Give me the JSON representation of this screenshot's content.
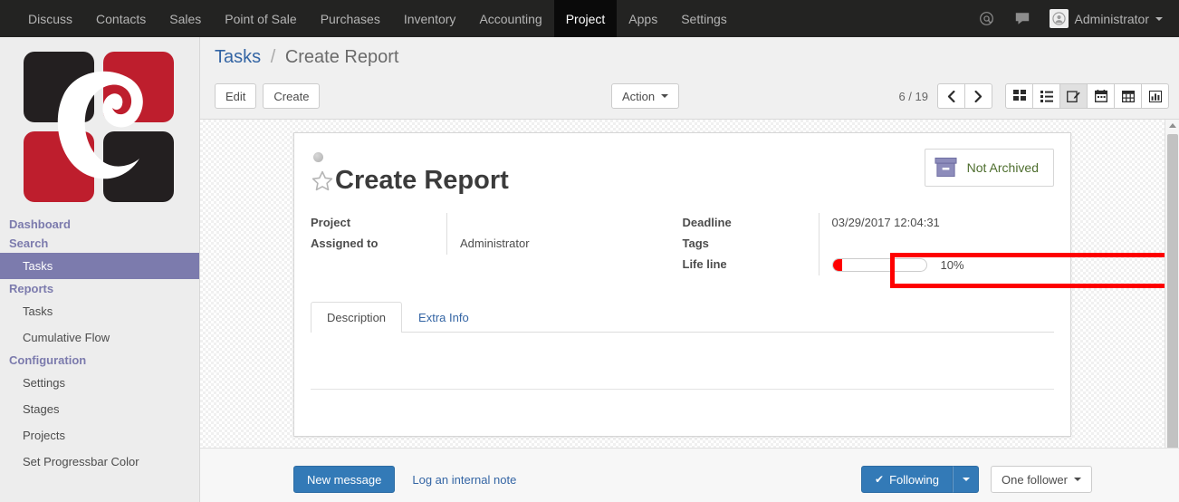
{
  "navbar": {
    "menus": [
      {
        "label": "Discuss",
        "active": false
      },
      {
        "label": "Contacts",
        "active": false
      },
      {
        "label": "Sales",
        "active": false
      },
      {
        "label": "Point of Sale",
        "active": false
      },
      {
        "label": "Purchases",
        "active": false
      },
      {
        "label": "Inventory",
        "active": false
      },
      {
        "label": "Accounting",
        "active": false
      },
      {
        "label": "Project",
        "active": true
      },
      {
        "label": "Apps",
        "active": false
      },
      {
        "label": "Settings",
        "active": false
      }
    ],
    "icons": [
      "at-sign-icon",
      "chat-bubble-icon"
    ],
    "user_name": "Administrator"
  },
  "sidebar": {
    "logo_name": "company-logo",
    "sections": [
      {
        "type": "group",
        "label": "Dashboard"
      },
      {
        "type": "group",
        "label": "Search"
      },
      {
        "type": "item",
        "label": "Tasks",
        "active": true
      },
      {
        "type": "group",
        "label": "Reports"
      },
      {
        "type": "item",
        "label": "Tasks",
        "active": false
      },
      {
        "type": "item",
        "label": "Cumulative Flow",
        "active": false
      },
      {
        "type": "group",
        "label": "Configuration"
      },
      {
        "type": "item",
        "label": "Settings",
        "active": false
      },
      {
        "type": "item",
        "label": "Stages",
        "active": false
      },
      {
        "type": "item",
        "label": "Projects",
        "active": false
      },
      {
        "type": "item",
        "label": "Set Progressbar Color",
        "active": false
      }
    ]
  },
  "control_panel": {
    "breadcrumb_root": "Tasks",
    "breadcrumb_sep": "/",
    "breadcrumb_current": "Create Report",
    "edit_label": "Edit",
    "create_label": "Create",
    "action_label": "Action",
    "pager_label": "6 / 19",
    "views": [
      {
        "name": "kanban-view-icon",
        "active": false
      },
      {
        "name": "list-view-icon",
        "active": false
      },
      {
        "name": "form-view-icon",
        "active": true
      },
      {
        "name": "calendar-view-icon",
        "active": false
      },
      {
        "name": "pivot-view-icon",
        "active": false
      },
      {
        "name": "graph-view-icon",
        "active": false
      }
    ]
  },
  "form": {
    "archive_button_label": "Not Archived",
    "record_title": "Create Report",
    "left_fields": [
      {
        "label": "Project",
        "value": ""
      },
      {
        "label": "Assigned to",
        "value": "Administrator"
      }
    ],
    "right_fields": [
      {
        "label": "Deadline",
        "value": "03/29/2017 12:04:31"
      },
      {
        "label": "Tags",
        "value": ""
      }
    ],
    "progress_field": {
      "label": "Life line",
      "percent_text": "10%",
      "percent_value": 10,
      "bar_color": "#ff0000"
    },
    "tabs": [
      {
        "label": "Description",
        "active": true
      },
      {
        "label": "Extra Info",
        "active": false
      }
    ]
  },
  "chatter": {
    "new_message_label": "New message",
    "log_note_label": "Log an internal note",
    "following_label": "Following",
    "following_check": "✔",
    "followers_label": "One follower"
  },
  "colors": {
    "navbar_bg": "#232322",
    "sidebar_active": "#7c7bad",
    "accent_link": "#3465a4",
    "primary_button": "#337ab7",
    "annotation": "#fe0000",
    "progress_fill": "#ff0000",
    "logo_red": "#be1e2d",
    "logo_black": "#231f20",
    "archive_text": "#4e6e2e"
  }
}
